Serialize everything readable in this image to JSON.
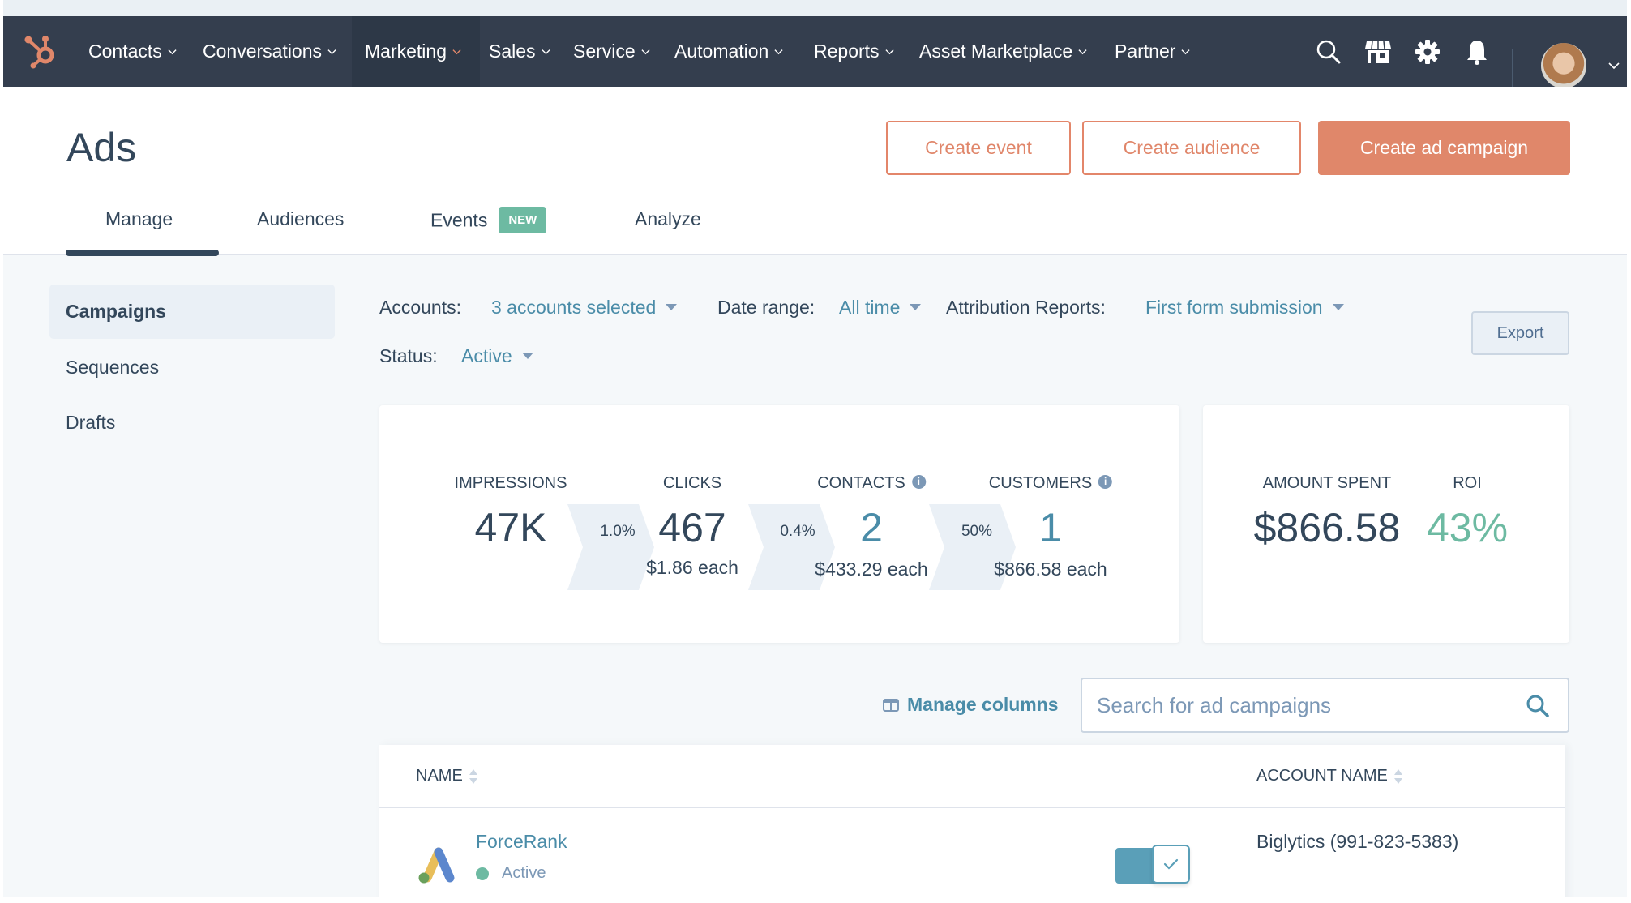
{
  "nav": {
    "items": [
      {
        "label": "Contacts"
      },
      {
        "label": "Conversations"
      },
      {
        "label": "Marketing",
        "active": true
      },
      {
        "label": "Sales"
      },
      {
        "label": "Service"
      },
      {
        "label": "Automation"
      },
      {
        "label": "Reports"
      },
      {
        "label": "Asset Marketplace"
      },
      {
        "label": "Partner"
      }
    ],
    "icons": [
      "search-icon",
      "marketplace-icon",
      "settings-icon",
      "notifications-icon"
    ],
    "brand_color": "#e0876a"
  },
  "header": {
    "title": "Ads",
    "buttons": {
      "create_event": "Create event",
      "create_audience": "Create audience",
      "create_ad_campaign": "Create ad campaign"
    },
    "tabs": [
      {
        "label": "Manage",
        "active": true
      },
      {
        "label": "Audiences"
      },
      {
        "label": "Events",
        "badge": "NEW"
      },
      {
        "label": "Analyze"
      }
    ]
  },
  "sidebar": {
    "items": [
      {
        "label": "Campaigns",
        "active": true
      },
      {
        "label": "Sequences"
      },
      {
        "label": "Drafts"
      }
    ]
  },
  "filters": {
    "accounts_label": "Accounts:",
    "accounts_value": "3 accounts selected",
    "date_range_label": "Date range:",
    "date_range_value": "All time",
    "attribution_label": "Attribution Reports:",
    "attribution_value": "First form submission",
    "status_label": "Status:",
    "status_value": "Active",
    "export_label": "Export"
  },
  "funnel": {
    "impressions": {
      "label": "IMPRESSIONS",
      "value": "47K"
    },
    "clicks": {
      "label": "CLICKS",
      "value": "467",
      "cost": "$1.86 each"
    },
    "contacts": {
      "label": "CONTACTS",
      "value": "2",
      "cost": "$433.29 each"
    },
    "customers": {
      "label": "CUSTOMERS",
      "value": "1",
      "cost": "$866.58 each"
    },
    "rates": [
      "1.0%",
      "0.4%",
      "50%"
    ]
  },
  "spend": {
    "amount_label": "AMOUNT SPENT",
    "amount_value": "$866.58",
    "roi_label": "ROI",
    "roi_value": "43%"
  },
  "table_controls": {
    "manage_columns": "Manage columns",
    "search_placeholder": "Search for ad campaigns"
  },
  "table": {
    "columns": [
      "NAME",
      "ACCOUNT NAME"
    ],
    "rows": [
      {
        "name": "ForceRank",
        "status": "Active",
        "enabled": true,
        "account": "Biglytics (991-823-5383)"
      }
    ]
  }
}
